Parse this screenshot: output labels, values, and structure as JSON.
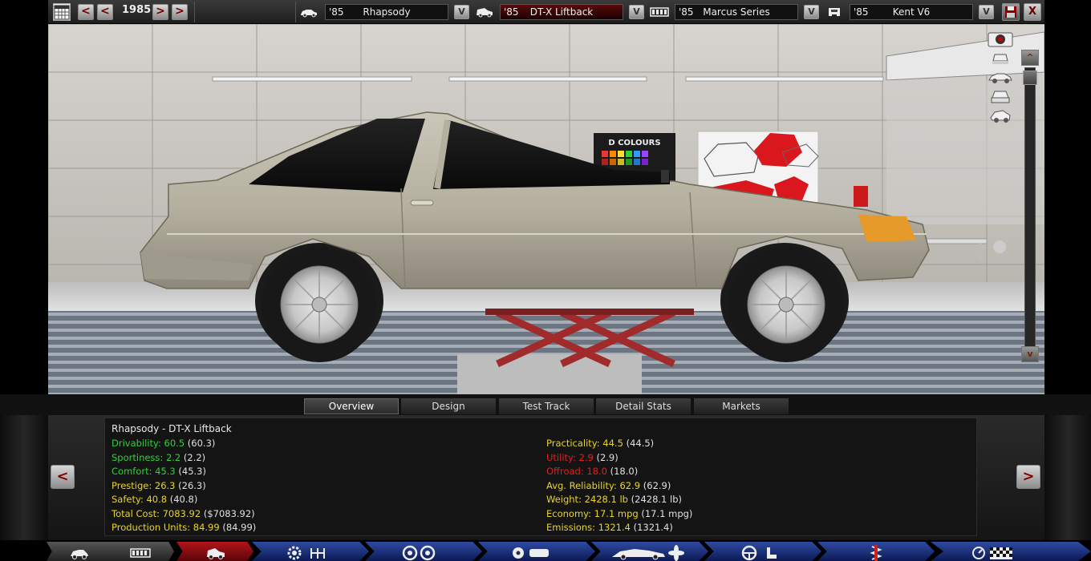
{
  "topbar": {
    "year": "1985",
    "nav_prev2": "<",
    "nav_prev": "<",
    "nav_next": ">",
    "nav_next2": ">",
    "model": {
      "year": "'85",
      "name": "Rhapsody"
    },
    "trim": {
      "year": "'85",
      "name": "DT-X Liftback"
    },
    "chassis": {
      "year": "'85",
      "name": "Marcus Series"
    },
    "engine": {
      "year": "'85",
      "name": "Kent V6"
    },
    "dropdown_glyph": "V",
    "close_glyph": "X"
  },
  "viewport": {
    "scroll_up": "^",
    "scroll_down": "v",
    "poster_text": "D COLOURS"
  },
  "tabs": [
    {
      "label": "Overview",
      "active": true
    },
    {
      "label": "Design",
      "active": false
    },
    {
      "label": "Test Track",
      "active": false
    },
    {
      "label": "Detail Stats",
      "active": false
    },
    {
      "label": "Markets",
      "active": false
    }
  ],
  "stats": {
    "title": "Rhapsody - DT-X Liftback",
    "left": [
      {
        "label": "Drivability: 60.5",
        "raw": " (60.3)",
        "color": "g"
      },
      {
        "label": "Sportiness: 2.2",
        "raw": " (2.2)",
        "color": "g"
      },
      {
        "label": "Comfort: 45.3",
        "raw": " (45.3)",
        "color": "g"
      },
      {
        "label": "Prestige: 26.3",
        "raw": " (26.3)",
        "color": "y"
      },
      {
        "label": "Safety: 40.8",
        "raw": " (40.8)",
        "color": "y"
      },
      {
        "label": "Total Cost: 7083.92",
        "raw": " ($7083.92)",
        "color": "y"
      },
      {
        "label": "Production Units: 84.99",
        "raw": " (84.99)",
        "color": "y"
      }
    ],
    "right": [
      {
        "label": "Practicality: 44.5",
        "raw": " (44.5)",
        "color": "y"
      },
      {
        "label": "Utility: 2.9",
        "raw": " (2.9)",
        "color": "r"
      },
      {
        "label": "Offroad: 18.0",
        "raw": " (18.0)",
        "color": "r"
      },
      {
        "label": "Avg. Reliability: 62.9",
        "raw": " (62.9)",
        "color": "y"
      },
      {
        "label": "Weight: 2428.1 lb",
        "raw": " (2428.1 lb)",
        "color": "y"
      },
      {
        "label": "Economy: 17.1 mpg",
        "raw": " (17.1 mpg)",
        "color": "y"
      },
      {
        "label": "Emissions: 1321.4",
        "raw": " (1321.4)",
        "color": "y"
      }
    ],
    "prev": "<",
    "next": ">"
  },
  "colors": {
    "good": "#2fd23a",
    "average": "#e8d42a",
    "bad": "#e02020",
    "nav_blue": "#2e4aa0",
    "nav_red": "#b3141a",
    "car_body": "#b9b4a4"
  },
  "icons": {
    "topbar": [
      "calendar-icon",
      "car-model-icon",
      "car-trim-icon",
      "chassis-icon",
      "engine-icon",
      "save-icon",
      "close-icon"
    ],
    "viewport": [
      "camera-icon",
      "view-front-icon",
      "view-side-icon",
      "view-rear-icon",
      "view-perspective-icon"
    ],
    "bottom_nav": [
      "car-icon",
      "chassis-icon",
      "car-trim-icon",
      "engine-gear-icon",
      "gearbox-icon",
      "wheels-icon",
      "brakes-icon",
      "body-icon",
      "fan-icon",
      "steering-icon",
      "seat-icon",
      "suspension-icon",
      "test-gauge-icon",
      "finish-flag-icon"
    ]
  }
}
